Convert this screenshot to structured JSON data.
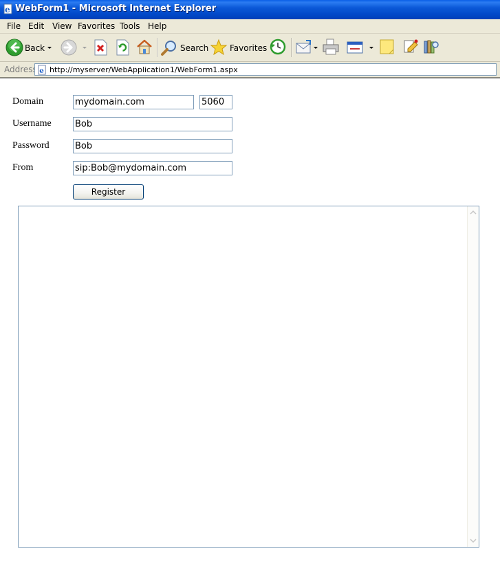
{
  "window": {
    "title": "WebForm1 - Microsoft Internet Explorer"
  },
  "menu": {
    "items": [
      "File",
      "Edit",
      "View",
      "Favorites",
      "Tools",
      "Help"
    ]
  },
  "toolbar": {
    "back_label": "Back",
    "search_label": "Search",
    "favorites_label": "Favorites"
  },
  "address": {
    "label": "Address",
    "url": "http://myserver/WebApplication1/WebForm1.aspx"
  },
  "form": {
    "domain_label": "Domain",
    "domain_value": "mydomain.com",
    "port_value": "5060",
    "username_label": "Username",
    "username_value": "Bob",
    "password_label": "Password",
    "password_value": "Bob",
    "from_label": "From",
    "from_value": "sip:Bob@mydomain.com",
    "register_label": "Register"
  },
  "log": {
    "text": ""
  },
  "colors": {
    "titlebar": "#0148c8",
    "chrome": "#ece9d8",
    "input_border": "#7f9db9"
  }
}
